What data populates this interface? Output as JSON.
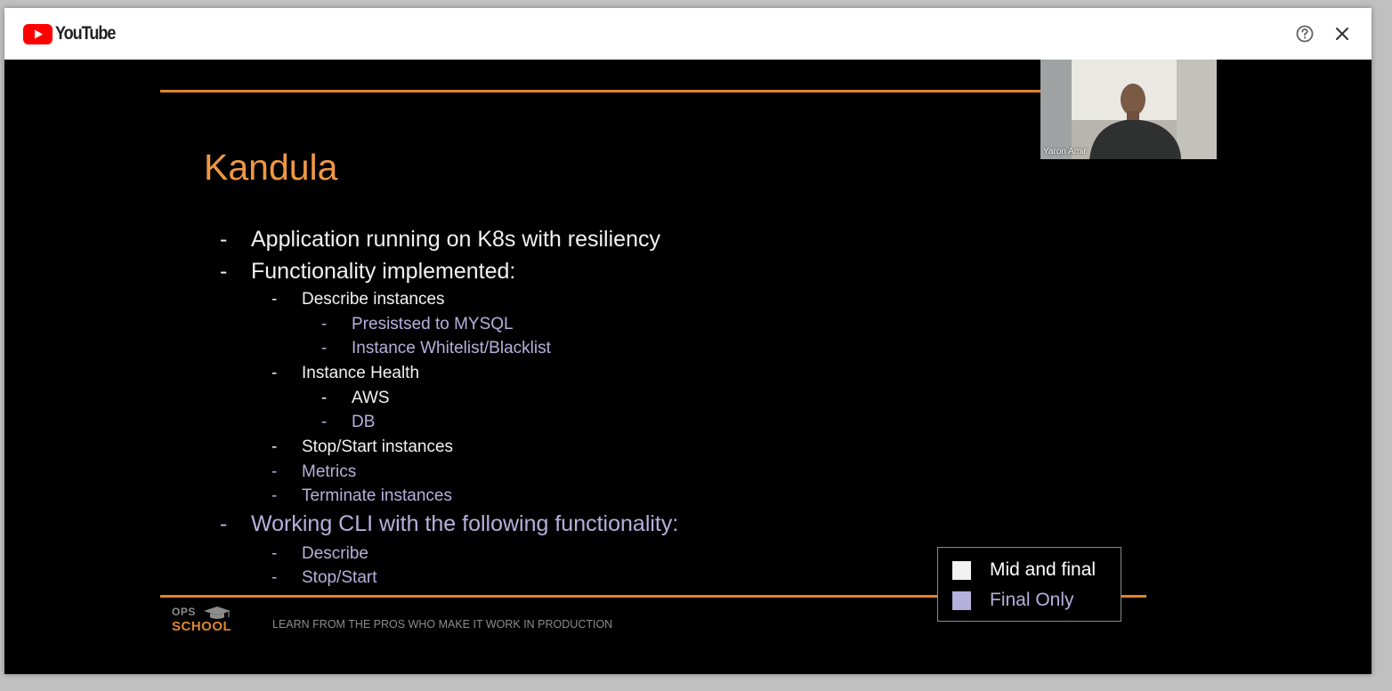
{
  "header": {
    "brand": "YouTube",
    "help_icon": "help-circle-icon",
    "close_icon": "close-icon",
    "brand_color": "#FF0000"
  },
  "slide": {
    "title": "Kandula",
    "bullets": [
      {
        "level": 1,
        "text": "Application running on K8s with resiliency",
        "status": "mid_and_final"
      },
      {
        "level": 1,
        "text": "Functionality implemented:",
        "status": "mid_and_final"
      },
      {
        "level": 2,
        "text": "Describe instances",
        "status": "mid_and_final"
      },
      {
        "level": 3,
        "text": "Presistsed to MYSQL",
        "status": "final_only"
      },
      {
        "level": 3,
        "text": "Instance Whitelist/Blacklist",
        "status": "final_only"
      },
      {
        "level": 2,
        "text": "Instance Health",
        "status": "mid_and_final"
      },
      {
        "level": 3,
        "text": "AWS",
        "status": "mid_and_final"
      },
      {
        "level": 3,
        "text": "DB",
        "status": "final_only"
      },
      {
        "level": 2,
        "text": "Stop/Start instances",
        "status": "mid_and_final"
      },
      {
        "level": 2,
        "text": "Metrics",
        "status": "final_only"
      },
      {
        "level": 2,
        "text": "Terminate instances",
        "status": "final_only"
      },
      {
        "level": 1,
        "text": "Working CLI with the following functionality:",
        "status": "final_only"
      },
      {
        "level": 2,
        "text": "Describe",
        "status": "final_only"
      },
      {
        "level": 2,
        "text": "Stop/Start",
        "status": "final_only"
      }
    ],
    "dash": "-",
    "legend": [
      {
        "label": "Mid and final",
        "color": "#F2F2F2"
      },
      {
        "label": "Final Only",
        "color": "#B6B0DC"
      }
    ],
    "footer": {
      "logo_top": "OPS",
      "logo_bottom": "SCHOOL",
      "tagline": "LEARN FROM THE PROS WHO MAKE IT WORK IN PRODUCTION"
    },
    "accent_color": "#E0852C",
    "title_color": "#EF9842"
  },
  "webcam": {
    "participant_name": "Yaron Amir"
  }
}
